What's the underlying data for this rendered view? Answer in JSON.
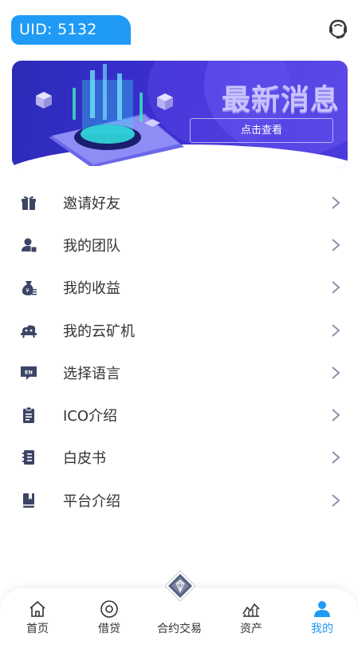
{
  "header": {
    "uid_label": "UID: 5132"
  },
  "banner": {
    "title": "最新消息",
    "button_label": "点击查看"
  },
  "menu": [
    {
      "label": "邀请好友",
      "icon": "gift-icon"
    },
    {
      "label": "我的团队",
      "icon": "team-icon"
    },
    {
      "label": "我的收益",
      "icon": "money-bag-icon"
    },
    {
      "label": "我的云矿机",
      "icon": "cloud-miner-icon"
    },
    {
      "label": "选择语言",
      "icon": "language-en-icon"
    },
    {
      "label": "ICO介绍",
      "icon": "document-icon"
    },
    {
      "label": "白皮书",
      "icon": "book-icon"
    },
    {
      "label": "平台介绍",
      "icon": "bookmark-book-icon"
    }
  ],
  "tabbar": [
    {
      "label": "首页",
      "icon": "home-icon",
      "active": false
    },
    {
      "label": "借贷",
      "icon": "target-circle-icon",
      "active": false
    },
    {
      "label": "合约交易",
      "icon": "diamond-icon",
      "active": false
    },
    {
      "label": "资产",
      "icon": "chart-icon",
      "active": false
    },
    {
      "label": "我的",
      "icon": "user-icon",
      "active": true
    }
  ],
  "colors": {
    "accent": "#1f9bf5",
    "icon": "#3d4566",
    "chevron": "#8a93ad"
  }
}
